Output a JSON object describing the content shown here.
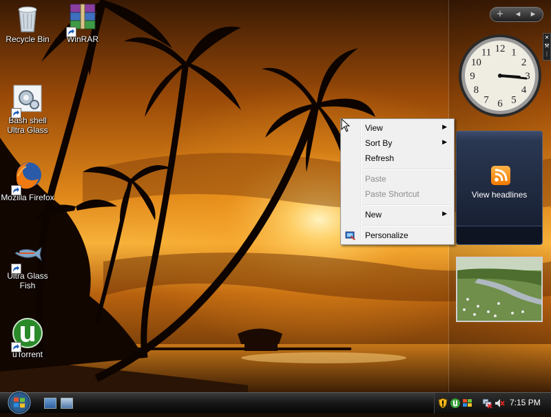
{
  "desktop_icons": [
    {
      "label": "Recycle Bin"
    },
    {
      "label": "WinRAR"
    },
    {
      "label": "Bash shell Ultra Glass"
    },
    {
      "label": "Mozilla Firefox"
    },
    {
      "label": "Ultra Glass Fish"
    },
    {
      "label": "uTorrent"
    }
  ],
  "sidebar": {
    "add_label": "+",
    "prev_label": "◂",
    "next_label": "▸",
    "feed_headlines_label": "View headlines",
    "clock_numbers": [
      "12",
      "1",
      "2",
      "3",
      "4",
      "5",
      "6",
      "7",
      "8",
      "9",
      "10",
      "11"
    ]
  },
  "context_menu": {
    "items": [
      {
        "label": "View",
        "submenu": true,
        "enabled": true
      },
      {
        "label": "Sort By",
        "submenu": true,
        "enabled": true
      },
      {
        "label": "Refresh",
        "submenu": false,
        "enabled": true
      },
      {
        "label": "Paste",
        "submenu": false,
        "enabled": false
      },
      {
        "label": "Paste Shortcut",
        "submenu": false,
        "enabled": false
      },
      {
        "label": "New",
        "submenu": true,
        "enabled": true
      },
      {
        "label": "Personalize",
        "submenu": false,
        "enabled": true
      }
    ],
    "submenu_arrow": "▶"
  },
  "taskbar": {
    "time": "7:15 PM"
  },
  "colors": {
    "menu_bg": "#f0f0f0",
    "disabled_text": "#8b8b8b",
    "sunset_orange": "#e8891a"
  }
}
